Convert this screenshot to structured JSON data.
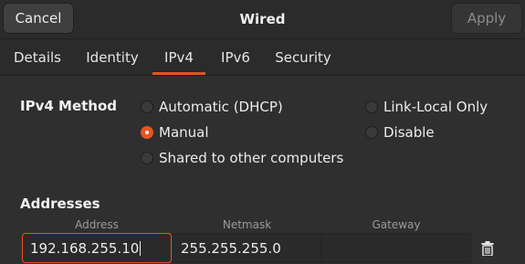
{
  "header": {
    "cancel_label": "Cancel",
    "title": "Wired",
    "apply_label": "Apply"
  },
  "tabs": [
    {
      "label": "Details"
    },
    {
      "label": "Identity"
    },
    {
      "label": "IPv4",
      "active": true
    },
    {
      "label": "IPv6"
    },
    {
      "label": "Security"
    }
  ],
  "method": {
    "label": "IPv4 Method",
    "options": [
      {
        "label": "Automatic (DHCP)",
        "checked": false
      },
      {
        "label": "Manual",
        "checked": true
      },
      {
        "label": "Shared to other computers",
        "checked": false
      },
      {
        "label": "Link-Local Only",
        "checked": false
      },
      {
        "label": "Disable",
        "checked": false
      }
    ]
  },
  "addresses": {
    "label": "Addresses",
    "columns": {
      "address": "Address",
      "netmask": "Netmask",
      "gateway": "Gateway"
    },
    "rows": [
      {
        "address": "192.168.255.10",
        "netmask": "255.255.255.0",
        "gateway": ""
      }
    ]
  },
  "icons": {
    "delete": "trash-icon"
  },
  "colors": {
    "accent": "#e95420",
    "background": "#2f2f2f"
  }
}
